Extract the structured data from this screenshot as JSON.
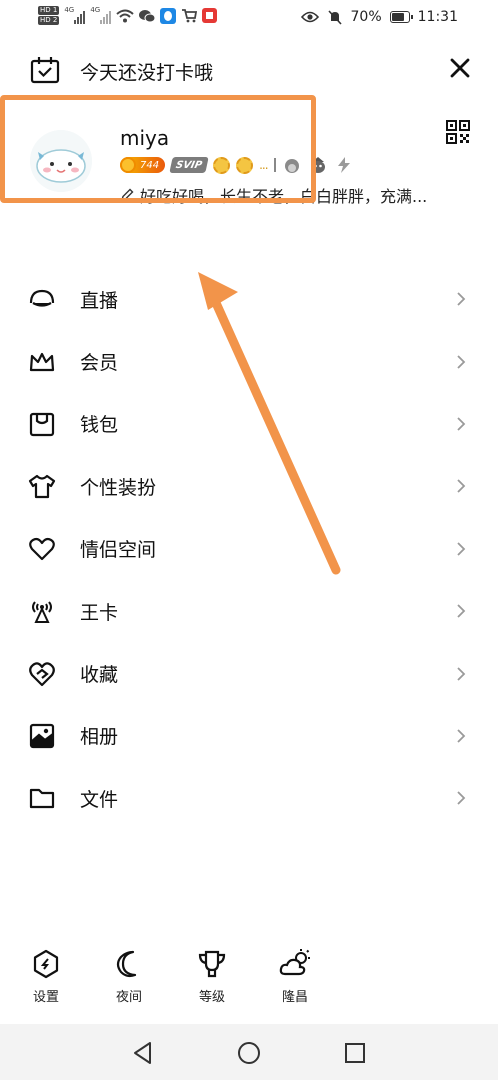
{
  "status_bar": {
    "hd_labels": [
      "HD 1",
      "HD 2"
    ],
    "net_labels": [
      "4G",
      "4G"
    ],
    "battery": "70%",
    "time": "11:31"
  },
  "top": {
    "checkin_text": "今天还没打卡哦"
  },
  "profile": {
    "username": "miya",
    "coin_value": "744",
    "svip_label": "SVIP",
    "dots": "...",
    "signature": "好吃好喝，长生不老，白白胖胖，充满..."
  },
  "menu": {
    "items": [
      {
        "label": "直播",
        "icon": "live-icon"
      },
      {
        "label": "会员",
        "icon": "crown-icon"
      },
      {
        "label": "钱包",
        "icon": "wallet-icon"
      },
      {
        "label": "个性装扮",
        "icon": "tshirt-icon"
      },
      {
        "label": "情侣空间",
        "icon": "heart-icon"
      },
      {
        "label": "王卡",
        "icon": "antenna-icon"
      },
      {
        "label": "收藏",
        "icon": "favorite-icon"
      },
      {
        "label": "相册",
        "icon": "album-icon"
      },
      {
        "label": "文件",
        "icon": "folder-icon"
      }
    ]
  },
  "bottom": {
    "settings": "设置",
    "night": "夜间",
    "level": "等级",
    "weather": "隆昌"
  },
  "colors": {
    "highlight": "#f2944a",
    "text": "#111111",
    "chevron": "#9a9a9a"
  }
}
